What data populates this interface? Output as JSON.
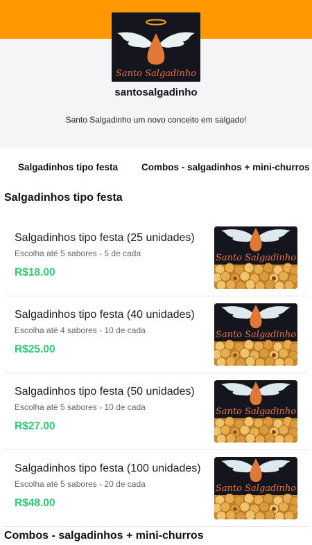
{
  "store": {
    "logo_text": "Santo Salgadinho",
    "name": "santosalgadinho",
    "description": "Santo Salgadinho um novo conceito em salgado!"
  },
  "category_tabs": [
    {
      "label": "Salgadinhos tipo festa"
    },
    {
      "label": "Combos - salgadinhos + mini-churros"
    }
  ],
  "sections": [
    {
      "title": "Salgadinhos tipo festa"
    },
    {
      "title": "Combos - salgadinhos + mini-churros"
    }
  ],
  "products": [
    {
      "name": "Salgadinhos tipo festa (25 unidades)",
      "description": "Escolha até 5 sabores - 5 de cada",
      "price": "R$18.00",
      "image_text": "Santo Salgadinho"
    },
    {
      "name": "Salgadinhos tipo festa (40 unidades)",
      "description": "Escolha até 4 sabores - 10 de cada",
      "price": "R$25.00",
      "image_text": "Santo Salgadinho"
    },
    {
      "name": "Salgadinhos tipo festa (50 unidades)",
      "description": "Escolha até 5 sabores - 10 de cada",
      "price": "R$27.00",
      "image_text": "Santo Salgadinho"
    },
    {
      "name": "Salgadinhos tipo festa (100 unidades)",
      "description": "Escolha até 5 sabores - 20 de cada",
      "price": "R$48.00",
      "image_text": "Santo Salgadinho"
    }
  ],
  "colors": {
    "topbar": "#ff9800",
    "price": "#2ecc71",
    "logo_text": "#e8734a"
  }
}
